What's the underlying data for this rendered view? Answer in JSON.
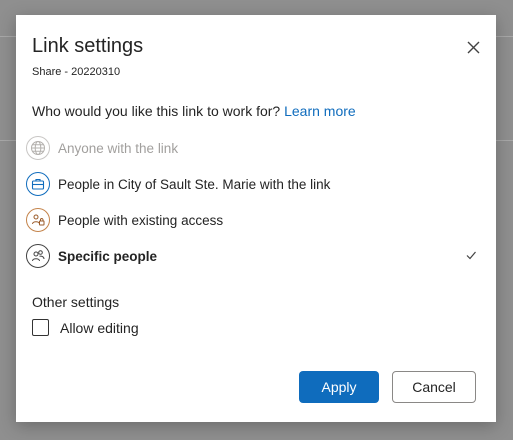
{
  "dialog": {
    "title": "Link settings",
    "subtitle": "Share - 20220310",
    "question": "Who would you like this link to work for?",
    "learn_more": "Learn more",
    "close_icon": "close-icon"
  },
  "options": [
    {
      "label": "Anyone with the link",
      "icon": "globe-icon",
      "state": "disabled"
    },
    {
      "label": "People in City of Sault Ste. Marie with the link",
      "icon": "briefcase-icon",
      "state": "normal"
    },
    {
      "label": "People with existing access",
      "icon": "people-lock-icon",
      "state": "normal"
    },
    {
      "label": "Specific people",
      "icon": "people-icon",
      "state": "selected"
    }
  ],
  "other_settings": {
    "heading": "Other settings",
    "allow_editing_label": "Allow editing",
    "allow_editing_checked": false
  },
  "buttons": {
    "apply": "Apply",
    "cancel": "Cancel"
  },
  "colors": {
    "accent": "#0f6cbd",
    "overlay": "#8f8f8f",
    "disabled_text": "#a19f9d"
  }
}
